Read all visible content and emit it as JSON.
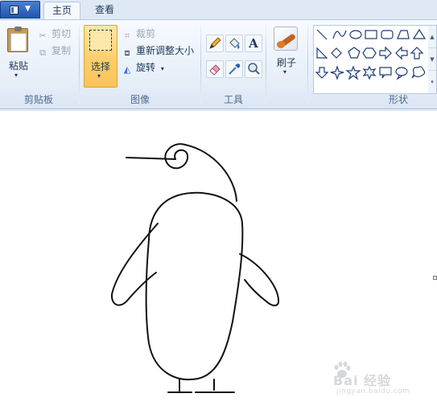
{
  "tabs": [
    {
      "label": "主页",
      "active": true
    },
    {
      "label": "查看",
      "active": false
    }
  ],
  "clipboard": {
    "paste_label": "粘贴",
    "cut_label": "剪切",
    "copy_label": "复制",
    "group_label": "剪贴板"
  },
  "image": {
    "select_label": "选择",
    "crop_label": "裁剪",
    "resize_label": "重新调整大小",
    "rotate_label": "旋转",
    "group_label": "图像"
  },
  "tools": {
    "group_label": "工具",
    "items": [
      "pencil-icon",
      "fill-bucket-icon",
      "text-icon",
      "eraser-icon",
      "color-picker-icon",
      "magnifier-icon"
    ]
  },
  "brushes": {
    "label": "刷子"
  },
  "shapes": {
    "group_label": "形状"
  },
  "watermark": {
    "brand": "Bai 经验",
    "url": "jingyan.baidu.com"
  },
  "colors": {
    "ribbon_bg": "#e6eef8",
    "select_highlight": "#fbcf6b",
    "label_text": "#4f6a8e"
  }
}
